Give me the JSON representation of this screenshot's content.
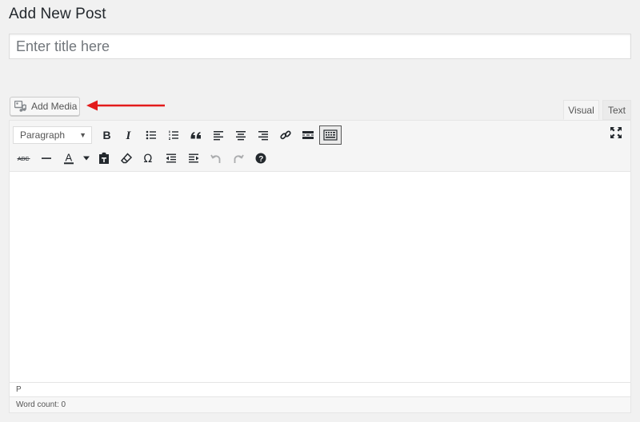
{
  "page": {
    "title": "Add New Post"
  },
  "post_title": {
    "placeholder": "Enter title here",
    "value": ""
  },
  "media": {
    "add_media_label": "Add Media"
  },
  "annotation": {
    "arrow_color": "#e31b1b"
  },
  "editor_tabs": {
    "visual_label": "Visual",
    "text_label": "Text",
    "active": "Visual"
  },
  "toolbar": {
    "format_select_value": "Paragraph",
    "row1": [
      "bold-icon",
      "italic-icon",
      "bulleted-list-icon",
      "numbered-list-icon",
      "blockquote-icon",
      "align-left-icon",
      "align-center-icon",
      "align-right-icon",
      "insert-link-icon",
      "read-more-icon",
      "toolbar-toggle-icon"
    ],
    "row2": [
      "strikethrough-icon",
      "horizontal-line-icon",
      "text-color-icon",
      "paste-as-text-icon",
      "clear-formatting-icon",
      "special-character-icon",
      "decrease-indent-icon",
      "increase-indent-icon",
      "undo-icon",
      "redo-icon",
      "help-icon"
    ],
    "strikethrough_glyph": "ABC",
    "text_color_glyph": "A",
    "omega_glyph": "Ω",
    "help_glyph": "?"
  },
  "editor": {
    "content": "",
    "path": "P",
    "word_count": "Word count: 0"
  }
}
